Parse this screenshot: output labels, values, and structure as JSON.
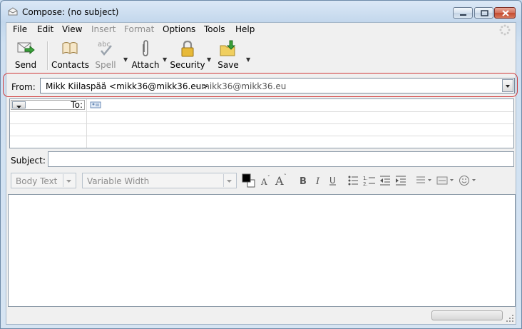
{
  "window": {
    "title": "Compose: (no subject)"
  },
  "menu": {
    "file": "File",
    "edit": "Edit",
    "view": "View",
    "insert": "Insert",
    "format": "Format",
    "options": "Options",
    "tools": "Tools",
    "help": "Help"
  },
  "toolbar": {
    "send": "Send",
    "contacts": "Contacts",
    "spell": "Spell",
    "attach": "Attach",
    "security": "Security",
    "save": "Save"
  },
  "from": {
    "label": "From:",
    "name": "Mikk Kiilaspää <mikk36@mikk36.eu>",
    "account": "- mikk36@mikk36.eu"
  },
  "recipients": {
    "type_label": "To:"
  },
  "subject": {
    "label": "Subject:",
    "value": ""
  },
  "format_bar": {
    "paragraph_style": "Body Text",
    "font": "Variable Width"
  },
  "colors": {
    "accent_highlight": "#d03a3a",
    "text_color": "#000000",
    "bg_color": "#ffffff"
  }
}
